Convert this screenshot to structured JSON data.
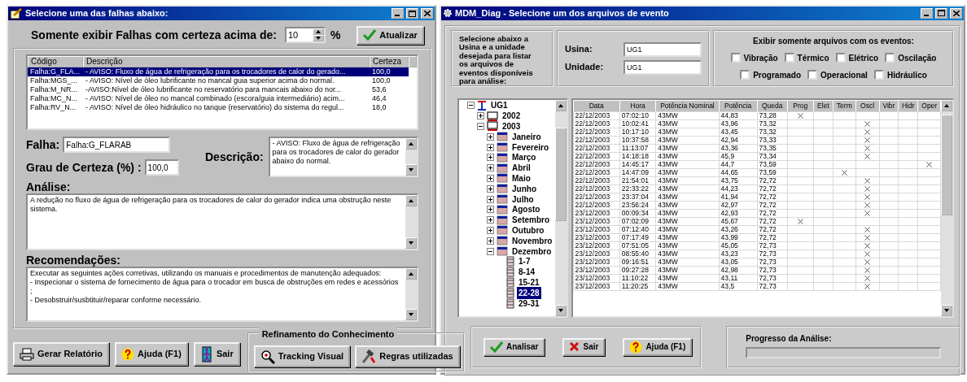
{
  "left_window": {
    "title": "Selecione uma das falhas abaixo:",
    "filter": {
      "label": "Somente exibir Falhas com certeza acima de:",
      "value": "10",
      "unit": "%",
      "button": "Atualizar"
    },
    "faults_table": {
      "columns": [
        "Código",
        "Descrição",
        "Certeza"
      ],
      "rows": [
        {
          "code": "Falha:G_FLA...",
          "description": "- AVISO: Fluxo de água de refrigeração para os trocadores de calor do gerado...",
          "certainty": "100,0",
          "selected": true
        },
        {
          "code": "Falha:MGS_...",
          "description": "- AVISO: Nível de óleo lubrificante no mancal guia superior acima do normal.",
          "certainty": "100,0",
          "selected": false
        },
        {
          "code": "Falha:M_NR...",
          "description": "-AVISO:Nível de óleo lubrificante no reservatório para mancais abaixo do nor...",
          "certainty": "53,6",
          "selected": false
        },
        {
          "code": "Falha:MC_N...",
          "description": "- AVISO: Nível de óleo no mancal combinado (escora/guia intermediário) acim...",
          "certainty": "46,4",
          "selected": false
        },
        {
          "code": "Falha:RV_N...",
          "description": "- AVISO: Nível de óleo hidráulico no tanque (reservatório) do sistema do regul...",
          "certainty": "18,0",
          "selected": false
        }
      ]
    },
    "falha": {
      "label": "Falha:",
      "value": "Falha:G_FLARAB"
    },
    "certeza": {
      "label": "Grau de Certeza (%) :",
      "value": "100,0"
    },
    "descricao": {
      "label": "Descrição:",
      "value": "- AVISO: Fluxo de água de refrigeração para os trocadores de calor do gerador abaixo do normal."
    },
    "analise": {
      "label": "Análise:",
      "value": "A redução no fluxo de água de refrigeração para os trocadores de calor do gerador indica uma obstrução neste sistema."
    },
    "recomendacoes": {
      "label": "Recomendações:",
      "value": "Executar as seguintes ações corretivas, utilizando os manuais e procedimentos de manutenção adequados:\n- Inspecionar o sistema de fornecimento de água para o trocador em busca de obstruções em redes e acessórios\n;\n- Desobstruir/susbtituir/reparar conforme necessário."
    },
    "buttons": [
      {
        "label": "Gerar Relatório",
        "kind": "print"
      },
      {
        "label": "Ajuda (F1)",
        "kind": "help"
      },
      {
        "label": "Sair",
        "kind": "exit"
      }
    ],
    "refinement": {
      "title": "Refinamento do Conhecimento",
      "buttons": [
        {
          "label": "Tracking Visual",
          "kind": "search"
        },
        {
          "label": "Regras utilizadas",
          "kind": "rules"
        }
      ]
    }
  },
  "right_window": {
    "title": "MDM_Diag - Selecione um dos arquivos de evento",
    "intro": "Selecione abaixo a Usina e a unidade desejada para listar os arquivos de eventos disponíveis para análise:",
    "usina": {
      "label": "Usina:",
      "value": "UG1"
    },
    "unidade": {
      "label": "Unidade:",
      "value": "UG1"
    },
    "events": {
      "title": "Exibir somente arquivos com os eventos:",
      "checkboxes": [
        {
          "label": "Vibração",
          "checked": false
        },
        {
          "label": "Térmico",
          "checked": false
        },
        {
          "label": "Elétrico",
          "checked": false
        },
        {
          "label": "Oscilação",
          "checked": false
        },
        {
          "label": "Programado",
          "checked": false
        },
        {
          "label": "Operacional",
          "checked": false
        },
        {
          "label": "Hidráulico",
          "checked": false
        }
      ]
    },
    "tree": [
      {
        "label": "UG1",
        "expanded": true,
        "selected": false,
        "children": [
          {
            "label": "2002",
            "expanded": false,
            "selected": false
          },
          {
            "label": "2003",
            "expanded": true,
            "selected": false,
            "children": [
              {
                "label": "Janeiro",
                "expanded": false,
                "selected": false
              },
              {
                "label": "Fevereiro",
                "expanded": false,
                "selected": false
              },
              {
                "label": "Março",
                "expanded": false,
                "selected": false
              },
              {
                "label": "Abril",
                "expanded": false,
                "selected": false
              },
              {
                "label": "Maio",
                "expanded": false,
                "selected": false
              },
              {
                "label": "Junho",
                "expanded": false,
                "selected": false
              },
              {
                "label": "Julho",
                "expanded": false,
                "selected": false
              },
              {
                "label": "Agosto",
                "expanded": false,
                "selected": false
              },
              {
                "label": "Setembro",
                "expanded": false,
                "selected": false
              },
              {
                "label": "Outubro",
                "expanded": false,
                "selected": false
              },
              {
                "label": "Novembro",
                "expanded": false,
                "selected": false
              },
              {
                "label": "Dezembro",
                "expanded": true,
                "selected": false,
                "children": [
                  {
                    "label": "1-7",
                    "selected": false
                  },
                  {
                    "label": "8-14",
                    "selected": false
                  },
                  {
                    "label": "15-21",
                    "selected": false
                  },
                  {
                    "label": "22-28",
                    "selected": true
                  },
                  {
                    "label": "29-31",
                    "selected": false
                  }
                ]
              }
            ]
          }
        ]
      }
    ],
    "events_table": {
      "columns": [
        "Data",
        "Hora",
        "Potência Nominal",
        "Potência",
        "Queda"
      ],
      "event_columns": [
        "Prog",
        "Elet",
        "Term",
        "Oscl",
        "Vibr",
        "Hidr",
        "Oper"
      ],
      "rows": [
        {
          "cells": [
            "22/12/2003",
            "07:02:10",
            "43MW",
            "44,83",
            "73,28"
          ],
          "marks": [
            true,
            false,
            false,
            false,
            false,
            false,
            false
          ]
        },
        {
          "cells": [
            "22/12/2003",
            "10:02:41",
            "43MW",
            "43,96",
            "73,32"
          ],
          "marks": [
            false,
            false,
            false,
            true,
            false,
            false,
            false
          ]
        },
        {
          "cells": [
            "22/12/2003",
            "10:17:10",
            "43MW",
            "43,45",
            "73,32"
          ],
          "marks": [
            false,
            false,
            false,
            true,
            false,
            false,
            false
          ]
        },
        {
          "cells": [
            "22/12/2003",
            "10:37:58",
            "43MW",
            "42,94",
            "73,33"
          ],
          "marks": [
            false,
            false,
            false,
            true,
            false,
            false,
            false
          ]
        },
        {
          "cells": [
            "22/12/2003",
            "11:13:07",
            "43MW",
            "43,36",
            "73,35"
          ],
          "marks": [
            false,
            false,
            false,
            true,
            false,
            false,
            false
          ]
        },
        {
          "cells": [
            "22/12/2003",
            "14:18:18",
            "43MW",
            "45,9",
            "73,34"
          ],
          "marks": [
            false,
            false,
            false,
            true,
            false,
            false,
            false
          ]
        },
        {
          "cells": [
            "22/12/2003",
            "14:45:17",
            "43MW",
            "44,7",
            "73,59"
          ],
          "marks": [
            false,
            false,
            false,
            false,
            false,
            false,
            true
          ]
        },
        {
          "cells": [
            "22/12/2003",
            "14:47:09",
            "43MW",
            "44,65",
            "73,59"
          ],
          "marks": [
            false,
            false,
            true,
            false,
            false,
            false,
            false
          ]
        },
        {
          "cells": [
            "22/12/2003",
            "21:54:01",
            "43MW",
            "43,75",
            "72,72"
          ],
          "marks": [
            false,
            false,
            false,
            true,
            false,
            false,
            false
          ]
        },
        {
          "cells": [
            "22/12/2003",
            "22:33:22",
            "43MW",
            "44,23",
            "72,72"
          ],
          "marks": [
            false,
            false,
            false,
            true,
            false,
            false,
            false
          ]
        },
        {
          "cells": [
            "22/12/2003",
            "23:37:04",
            "43MW",
            "41,94",
            "72,72"
          ],
          "marks": [
            false,
            false,
            false,
            true,
            false,
            false,
            false
          ]
        },
        {
          "cells": [
            "22/12/2003",
            "23:56:24",
            "43MW",
            "42,97",
            "72,72"
          ],
          "marks": [
            false,
            false,
            false,
            true,
            false,
            false,
            false
          ]
        },
        {
          "cells": [
            "23/12/2003",
            "00:09:34",
            "43MW",
            "42,93",
            "72,72"
          ],
          "marks": [
            false,
            false,
            false,
            true,
            false,
            false,
            false
          ]
        },
        {
          "cells": [
            "23/12/2003",
            "07:02:09",
            "43MW",
            "45,67",
            "72,72"
          ],
          "marks": [
            true,
            false,
            false,
            false,
            false,
            false,
            false
          ]
        },
        {
          "cells": [
            "23/12/2003",
            "07:12:40",
            "43MW",
            "43,26",
            "72,72"
          ],
          "marks": [
            false,
            false,
            false,
            true,
            false,
            false,
            false
          ]
        },
        {
          "cells": [
            "23/12/2003",
            "07:17:49",
            "43MW",
            "43,99",
            "72,72"
          ],
          "marks": [
            false,
            false,
            false,
            true,
            false,
            false,
            false
          ]
        },
        {
          "cells": [
            "23/12/2003",
            "07:51:05",
            "43MW",
            "45,05",
            "72,73"
          ],
          "marks": [
            false,
            false,
            false,
            true,
            false,
            false,
            false
          ]
        },
        {
          "cells": [
            "23/12/2003",
            "08:55:40",
            "43MW",
            "43,23",
            "72,73"
          ],
          "marks": [
            false,
            false,
            false,
            true,
            false,
            false,
            false
          ]
        },
        {
          "cells": [
            "23/12/2003",
            "09:16:51",
            "43MW",
            "43,05",
            "72,73"
          ],
          "marks": [
            false,
            false,
            false,
            true,
            false,
            false,
            false
          ]
        },
        {
          "cells": [
            "23/12/2003",
            "09:27:28",
            "43MW",
            "42,98",
            "72,73"
          ],
          "marks": [
            false,
            false,
            false,
            true,
            false,
            false,
            false
          ]
        },
        {
          "cells": [
            "23/12/2003",
            "11:10:22",
            "43MW",
            "43,11",
            "72,73"
          ],
          "marks": [
            false,
            false,
            false,
            true,
            false,
            false,
            false
          ]
        },
        {
          "cells": [
            "23/12/2003",
            "11:20:25",
            "43MW",
            "43,5",
            "72,73"
          ],
          "marks": [
            false,
            false,
            false,
            true,
            false,
            false,
            false
          ]
        }
      ]
    },
    "buttons": [
      {
        "label": "Analisar",
        "kind": "check"
      },
      {
        "label": "Sair",
        "kind": "cross"
      },
      {
        "label": "Ajuda (F1)",
        "kind": "help"
      }
    ],
    "progress": {
      "label": "Progresso da Análise:",
      "level": 0
    }
  }
}
